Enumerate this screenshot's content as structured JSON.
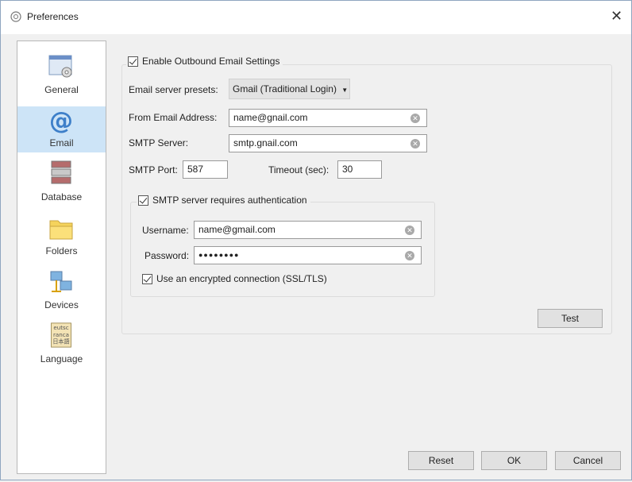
{
  "window": {
    "title": "Preferences",
    "close_icon": "close-icon"
  },
  "sidebar": {
    "items": [
      {
        "label": "General",
        "icon": "general-settings-icon"
      },
      {
        "label": "Email",
        "icon": "at-sign-icon",
        "selected": true
      },
      {
        "label": "Database",
        "icon": "database-icon"
      },
      {
        "label": "Folders",
        "icon": "folder-icon"
      },
      {
        "label": "Devices",
        "icon": "network-devices-icon"
      },
      {
        "label": "Language",
        "icon": "language-icon"
      }
    ]
  },
  "email": {
    "enable_label": "Enable Outbound Email Settings",
    "enable_checked": true,
    "presets_label": "Email server presets:",
    "presets_value": "Gmail (Traditional Login)",
    "from_label": "From Email Address:",
    "from_value": "name@gnail.com",
    "smtp_label": "SMTP Server:",
    "smtp_value": "smtp.gnail.com",
    "port_label": "SMTP Port:",
    "port_value": "587",
    "timeout_label": "Timeout (sec):",
    "timeout_value": "30",
    "auth": {
      "label": "SMTP server requires authentication",
      "checked": true,
      "username_label": "Username:",
      "username_value": "name@gmail.com",
      "password_label": "Password:",
      "password_value": "●●●●●●●●",
      "ssl_label": "Use an encrypted connection (SSL/TLS)",
      "ssl_checked": true
    },
    "test_label": "Test"
  },
  "footer": {
    "reset": "Reset",
    "ok": "OK",
    "cancel": "Cancel"
  }
}
